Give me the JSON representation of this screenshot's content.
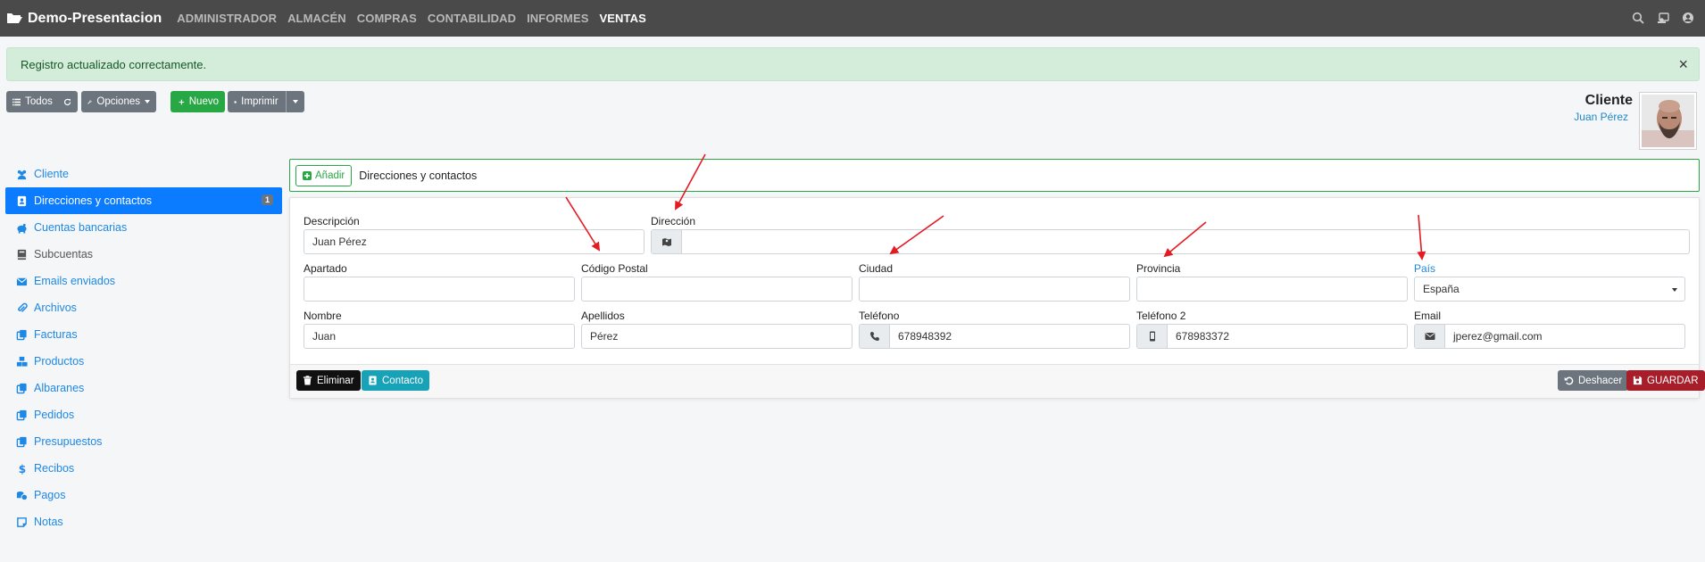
{
  "app": {
    "title": "Demo-Presentacion",
    "nav": [
      "ADMINISTRADOR",
      "ALMACÉN",
      "COMPRAS",
      "CONTABILIDAD",
      "INFORMES",
      "VENTAS"
    ],
    "active_nav": "VENTAS",
    "top_icons": [
      "search-icon",
      "contact-card-icon",
      "user-icon"
    ]
  },
  "alert": {
    "message": "Registro actualizado correctamente.",
    "close": "×"
  },
  "toolbar": {
    "all_label": "Todos",
    "options_label": "Opciones",
    "new_label": "Nuevo",
    "print_label": "Imprimir"
  },
  "header": {
    "title": "Cliente",
    "name": "Juan Pérez"
  },
  "sidebar": {
    "items": [
      {
        "label": "Cliente",
        "icon": "users-icon"
      },
      {
        "label": "Direcciones y contactos",
        "icon": "address-book-icon",
        "badge": "1",
        "active": true
      },
      {
        "label": "Cuentas bancarias",
        "icon": "piggy-bank-icon"
      },
      {
        "label": "Subcuentas",
        "icon": "book-icon"
      },
      {
        "label": "Emails enviados",
        "icon": "envelope-icon"
      },
      {
        "label": "Archivos",
        "icon": "paperclip-icon"
      },
      {
        "label": "Facturas",
        "icon": "copy-icon"
      },
      {
        "label": "Productos",
        "icon": "cubes-icon"
      },
      {
        "label": "Albaranes",
        "icon": "copy-icon"
      },
      {
        "label": "Pedidos",
        "icon": "copy-icon"
      },
      {
        "label": "Presupuestos",
        "icon": "copy-icon"
      },
      {
        "label": "Recibos",
        "icon": "dollar-icon"
      },
      {
        "label": "Pagos",
        "icon": "coins-icon"
      },
      {
        "label": "Notas",
        "icon": "sticky-note-icon"
      }
    ]
  },
  "section": {
    "add_label": "Añadir",
    "title": "Direcciones y contactos"
  },
  "form": {
    "descripcion": {
      "label": "Descripción",
      "value": "Juan Pérez"
    },
    "direccion": {
      "label": "Dirección",
      "value": ""
    },
    "apartado": {
      "label": "Apartado",
      "value": ""
    },
    "codigo_postal": {
      "label": "Código Postal",
      "value": ""
    },
    "ciudad": {
      "label": "Ciudad",
      "value": ""
    },
    "provincia": {
      "label": "Provincia",
      "value": ""
    },
    "pais": {
      "label": "País",
      "value": "España"
    },
    "nombre": {
      "label": "Nombre",
      "value": "Juan"
    },
    "apellidos": {
      "label": "Apellidos",
      "value": "Pérez"
    },
    "telefono": {
      "label": "Teléfono",
      "value": "678948392"
    },
    "telefono2": {
      "label": "Teléfono 2",
      "value": "678983372"
    },
    "email": {
      "label": "Email",
      "value": "jperez@gmail.com"
    }
  },
  "footer": {
    "delete_label": "Eliminar",
    "contact_label": "Contacto",
    "undo_label": "Deshacer",
    "save_label": "GUARDAR"
  },
  "colors": {
    "topbar": "#4a4a4a",
    "accent": "#0b7bff",
    "success": "#28a745",
    "danger": "#a71d2a",
    "annotation": "#e31b23"
  }
}
